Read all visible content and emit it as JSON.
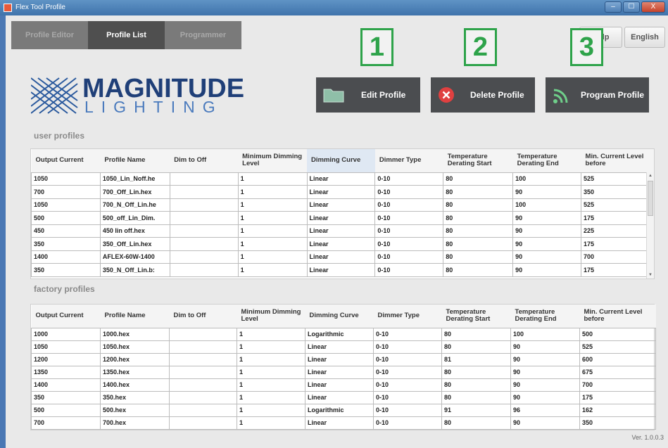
{
  "window": {
    "title": "Flex Tool Profile",
    "controls": [
      "–",
      "☐",
      "X"
    ]
  },
  "tabs": [
    "Profile Editor",
    "Profile List",
    "Programmer"
  ],
  "top_buttons": {
    "help": "Help",
    "english": "English"
  },
  "logo": {
    "word": "MAGNITUDE",
    "sub": "LIGHTING"
  },
  "callouts": [
    "1",
    "2",
    "3"
  ],
  "actions": {
    "edit": "Edit Profile",
    "delete": "Delete Profile",
    "program": "Program Profile"
  },
  "sections": {
    "user": "user profiles",
    "factory": "factory profiles"
  },
  "columns": [
    "Output Current",
    "Profile Name",
    "Dim to Off",
    "Minimum Dimming Level",
    "Dimming Curve",
    "Dimmer Type",
    "Temperature Derating Start",
    "Temperature Derating End",
    "Min. Current Level before"
  ],
  "user_rows": [
    [
      "1050",
      "1050_Lin_Noff.he",
      "",
      "1",
      "Linear",
      "0-10",
      "80",
      "100",
      "525"
    ],
    [
      "700",
      "700_Off_Lin.hex",
      "",
      "1",
      "Linear",
      "0-10",
      "80",
      "90",
      "350"
    ],
    [
      "1050",
      "700_N_Off_Lin.he",
      "",
      "1",
      "Linear",
      "0-10",
      "80",
      "100",
      "525"
    ],
    [
      "500",
      "500_off_Lin_Dim.",
      "",
      "1",
      "Linear",
      "0-10",
      "80",
      "90",
      "175"
    ],
    [
      "450",
      "450 lin off.hex",
      "",
      "1",
      "Linear",
      "0-10",
      "80",
      "90",
      "225"
    ],
    [
      "350",
      "350_Off_Lin.hex",
      "",
      "1",
      "Linear",
      "0-10",
      "80",
      "90",
      "175"
    ],
    [
      "1400",
      "AFLEX-60W-1400",
      "",
      "1",
      "Linear",
      "0-10",
      "80",
      "90",
      "700"
    ],
    [
      "350",
      "350_N_Off_Lin.b:",
      "",
      "1",
      "Linear",
      "0-10",
      "80",
      "90",
      "175"
    ]
  ],
  "factory_rows": [
    [
      "1000",
      "1000.hex",
      "",
      "1",
      "Logarithmic",
      "0-10",
      "80",
      "100",
      "500"
    ],
    [
      "1050",
      "1050.hex",
      "",
      "1",
      "Linear",
      "0-10",
      "80",
      "90",
      "525"
    ],
    [
      "1200",
      "1200.hex",
      "",
      "1",
      "Linear",
      "0-10",
      "81",
      "90",
      "600"
    ],
    [
      "1350",
      "1350.hex",
      "",
      "1",
      "Linear",
      "0-10",
      "80",
      "90",
      "675"
    ],
    [
      "1400",
      "1400.hex",
      "",
      "1",
      "Linear",
      "0-10",
      "80",
      "90",
      "700"
    ],
    [
      "350",
      "350.hex",
      "",
      "1",
      "Linear",
      "0-10",
      "80",
      "90",
      "175"
    ],
    [
      "500",
      "500.hex",
      "",
      "1",
      "Logarithmic",
      "0-10",
      "91",
      "96",
      "162"
    ],
    [
      "700",
      "700.hex",
      "",
      "1",
      "Linear",
      "0-10",
      "80",
      "90",
      "350"
    ]
  ],
  "version": "Ver. 1.0.0.3",
  "colors": {
    "action_bg": "#4b4d50",
    "callout": "#2ea34a",
    "brand": "#1f3f78",
    "swatch": "#555f6d"
  }
}
